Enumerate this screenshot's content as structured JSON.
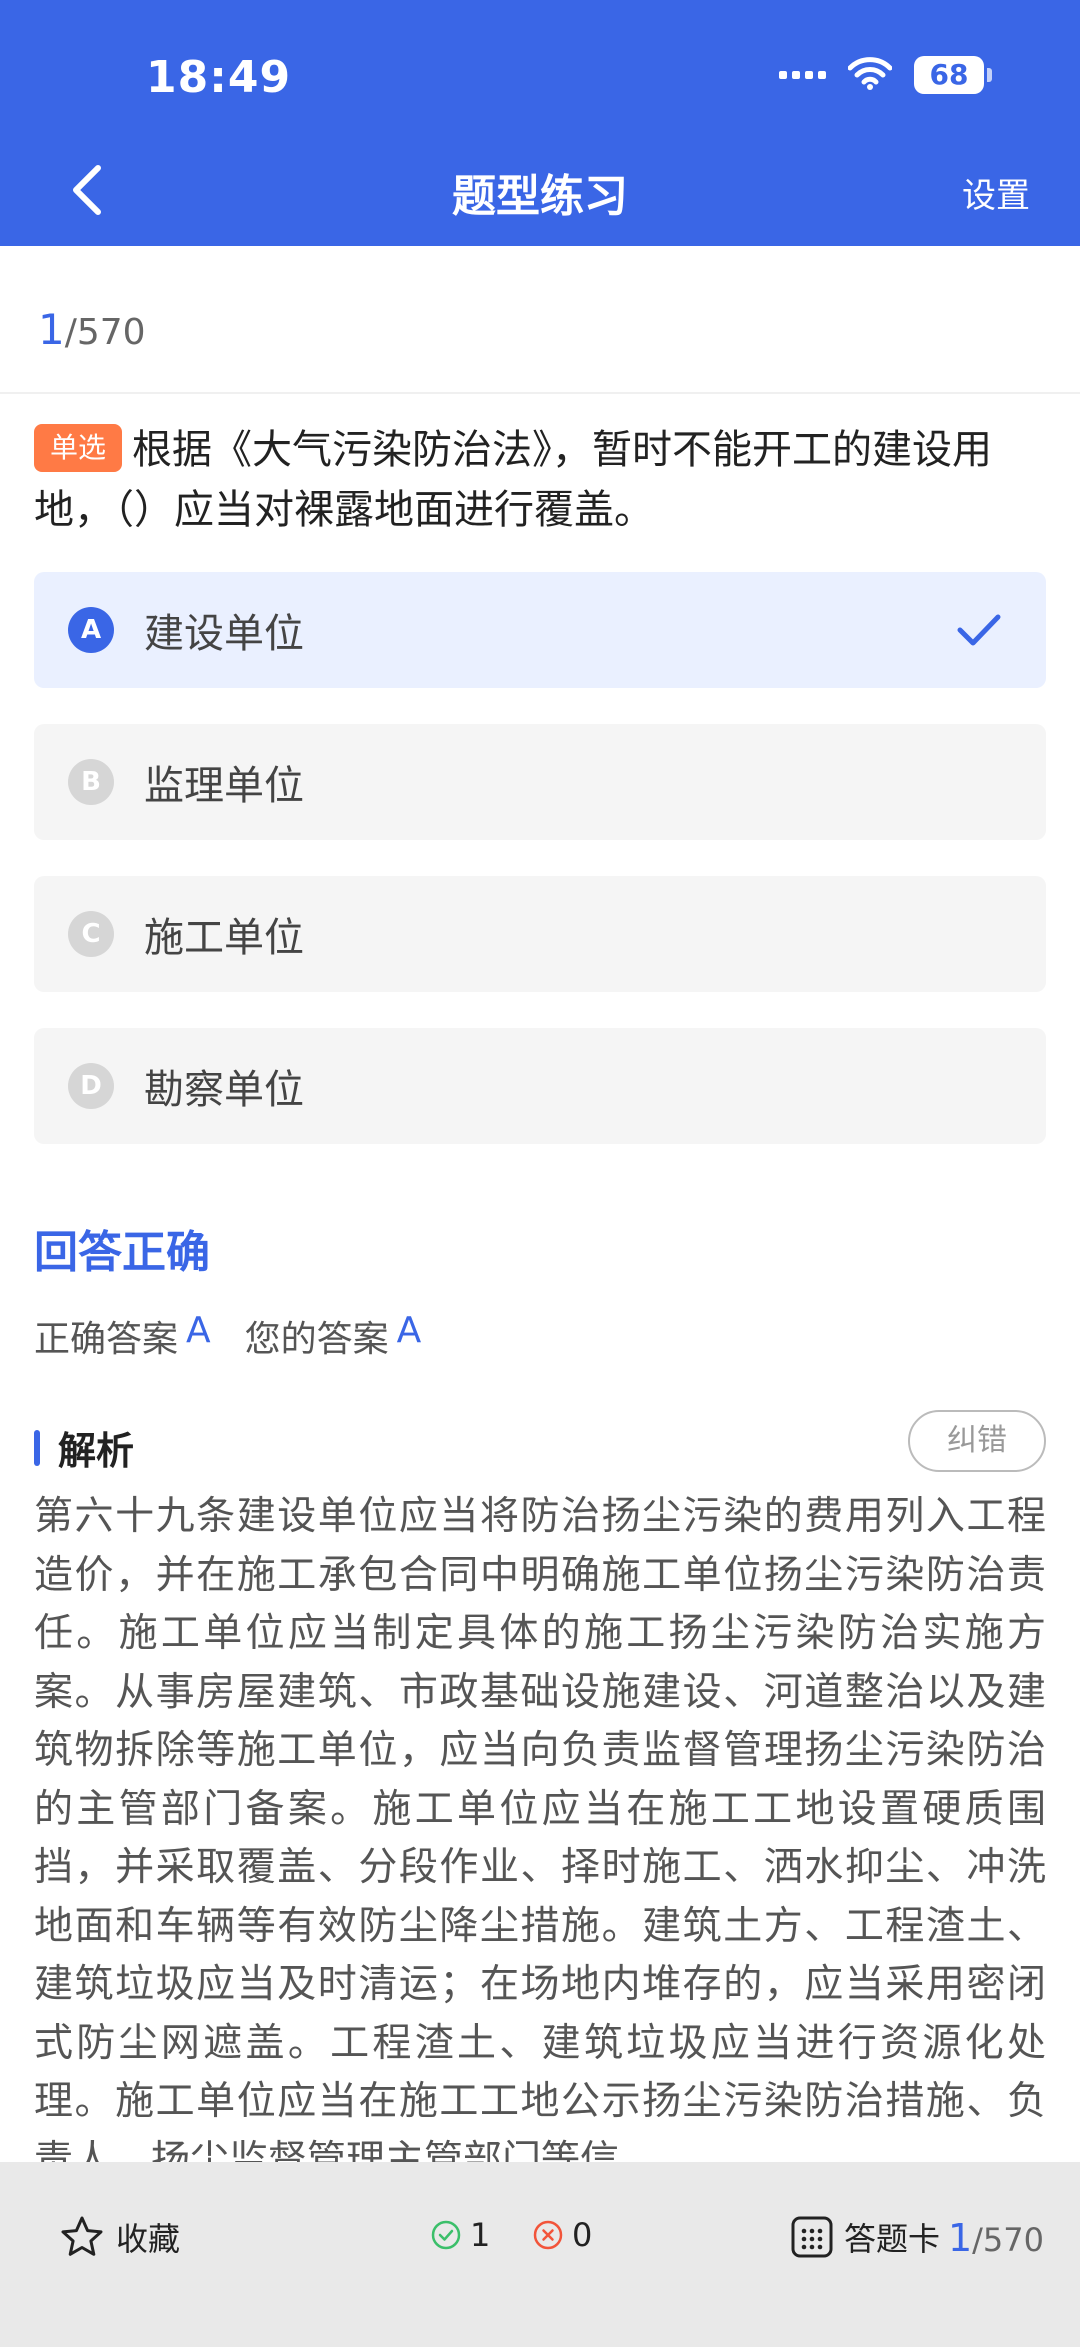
{
  "status_bar": {
    "time": "18:49",
    "battery": "68"
  },
  "header": {
    "title": "题型练习",
    "settings_label": "设置"
  },
  "progress": {
    "current": "1",
    "total": "/570"
  },
  "question": {
    "type_badge": "单选",
    "text": "根据《大气污染防治法》，暂时不能开工的建设用地，（）应当对裸露地面进行覆盖。"
  },
  "options": [
    {
      "letter": "A",
      "text": "建设单位",
      "selected": true
    },
    {
      "letter": "B",
      "text": "监理单位",
      "selected": false
    },
    {
      "letter": "C",
      "text": "施工单位",
      "selected": false
    },
    {
      "letter": "D",
      "text": "勘察单位",
      "selected": false
    }
  ],
  "result": {
    "title": "回答正确",
    "correct_label": "正确答案",
    "correct_value": "A",
    "yours_label": "您的答案",
    "yours_value": "A"
  },
  "analysis": {
    "title": "解析",
    "report_label": "纠错",
    "text": "第六十九条建设单位应当将防治扬尘污染的费用列入工程造价，并在施工承包合同中明确施工单位扬尘污染防治责任。施工单位应当制定具体的施工扬尘污染防治实施方案。从事房屋建筑、市政基础设施建设、河道整治以及建筑物拆除等施工单位，应当向负责监督管理扬尘污染防治的主管部门备案。施工单位应当在施工工地设置硬质围挡，并采取覆盖、分段作业、择时施工、洒水抑尘、冲洗地面和车辆等有效防尘降尘措施。建筑土方、工程渣土、建筑垃圾应当及时清运；在场地内堆存的，应当采用密闭式防尘网遮盖。工程渣土、建筑垃圾应当进行资源化处理。施工单位应当在施工工地公示扬尘污染防治措施、负责人、扬尘监督管理主管部门等信"
  },
  "bottom_bar": {
    "favorite_label": "收藏",
    "correct_count": "1",
    "wrong_count": "0",
    "card_label": "答题卡",
    "progress_current": "1",
    "progress_total": "/570"
  },
  "colors": {
    "primary": "#3a66e6",
    "badge": "#ff7a45",
    "selected_bg": "#eaf0ff",
    "option_bg": "#f5f5f5",
    "correct": "#3bbf6a",
    "wrong": "#f2543a"
  }
}
